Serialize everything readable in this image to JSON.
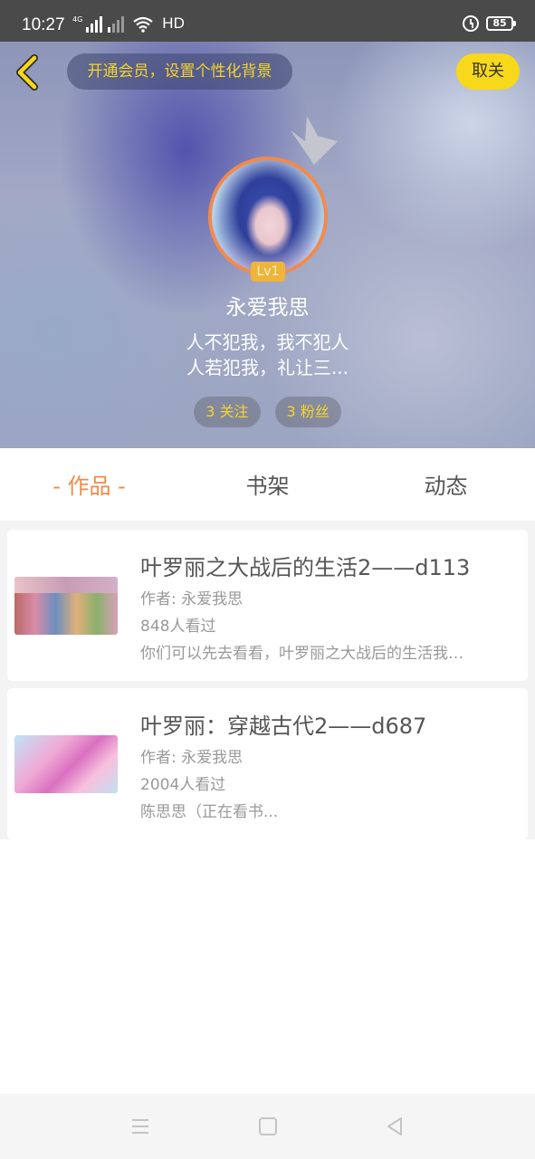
{
  "status_bar": {
    "time": "10:27",
    "network": "4G",
    "hd": "HD",
    "battery": "85",
    "icons": [
      "signal-icon",
      "signal-weak-icon",
      "wifi-icon",
      "alarm-icon",
      "battery-icon"
    ]
  },
  "header": {
    "vip_banner": "开通会员，设置个性化背景",
    "close_label": "取关",
    "level": "Lv1",
    "nickname": "永爱我思",
    "signature_line1": "人不犯我，我不犯人",
    "signature_line2": "人若犯我，礼让三...",
    "following": "3 关注",
    "followers": "3 粉丝",
    "accent_color": "#f8d81a"
  },
  "tabs": [
    {
      "label": "- 作品 -",
      "active": true
    },
    {
      "label": "书架",
      "active": false
    },
    {
      "label": "动态",
      "active": false
    }
  ],
  "works": [
    {
      "title": "叶罗丽之大战后的生活2——d113",
      "author": "作者: 永爱我思",
      "views": "848人看过",
      "description": "你们可以先去看看，叶罗丽之大战后的生活我…"
    },
    {
      "title": "叶罗丽：穿越古代2——d687",
      "author": "作者: 永爱我思",
      "views": "2004人看过",
      "description": "陈思思（正在看书..."
    }
  ],
  "nav_bar": {
    "icons": [
      "menu-icon",
      "home-icon",
      "back-icon"
    ]
  }
}
